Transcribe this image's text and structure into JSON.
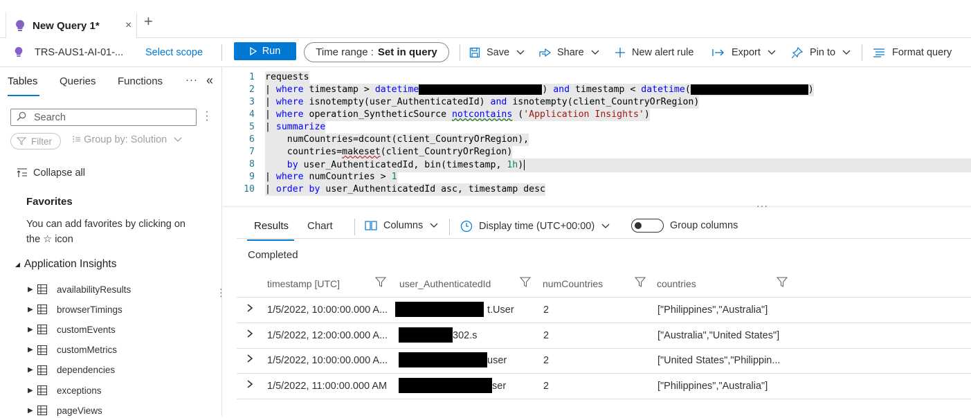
{
  "tab": {
    "title": "New Query 1*",
    "close": "×",
    "add": "+"
  },
  "toolbar": {
    "scope_name": "TRS-AUS1-AI-01-...",
    "select_scope": "Select scope",
    "run": "Run",
    "time_range_label": "Time range :",
    "time_range_value": "Set in query",
    "save": "Save",
    "share": "Share",
    "new_alert_rule": "New alert rule",
    "export": "Export",
    "pin_to": "Pin to",
    "format_query": "Format query"
  },
  "left_pane": {
    "tabs": [
      "Tables",
      "Queries",
      "Functions"
    ],
    "more": "···",
    "collapse": "«",
    "search_placeholder": "Search",
    "filter": "Filter",
    "group_by": "Group by: Solution",
    "collapse_all": "Collapse all",
    "favorites_title": "Favorites",
    "favorites_text_1": "You can add favorites by clicking on",
    "favorites_text_2": "the ☆ icon",
    "section": "Application Insights",
    "tables": [
      "availabilityResults",
      "browserTimings",
      "customEvents",
      "customMetrics",
      "dependencies",
      "exceptions",
      "pageViews"
    ]
  },
  "editor": {
    "line_numbers": [
      "1",
      "2",
      "3",
      "4",
      "5",
      "6",
      "7",
      "8",
      "9",
      "10"
    ]
  },
  "results": {
    "tabs": [
      "Results",
      "Chart"
    ],
    "columns_btn": "Columns",
    "display_time": "Display time (UTC+00:00)",
    "group_columns": "Group columns",
    "status": "Completed",
    "headers": [
      "timestamp [UTC]",
      "user_AuthenticatedId",
      "numCountries",
      "countries"
    ],
    "rows": [
      {
        "timestamp": "1/5/2022, 10:00:00.000 A...",
        "user": "t.User",
        "num": "2",
        "countries": "[\"Philippines\",\"Australia\"]"
      },
      {
        "timestamp": "1/5/2022, 12:00:00.000 A...",
        "user": "302.s",
        "num": "2",
        "countries": "[\"Australia\",\"United States\"]"
      },
      {
        "timestamp": "1/5/2022, 10:00:00.000 A...",
        "user": "user",
        "num": "2",
        "countries": "[\"United States\",\"Philippin..."
      },
      {
        "timestamp": "1/5/2022, 11:00:00.000 AM",
        "user": "ser",
        "num": "2",
        "countries": "[\"Philippines\",\"Australia\"]"
      }
    ]
  }
}
